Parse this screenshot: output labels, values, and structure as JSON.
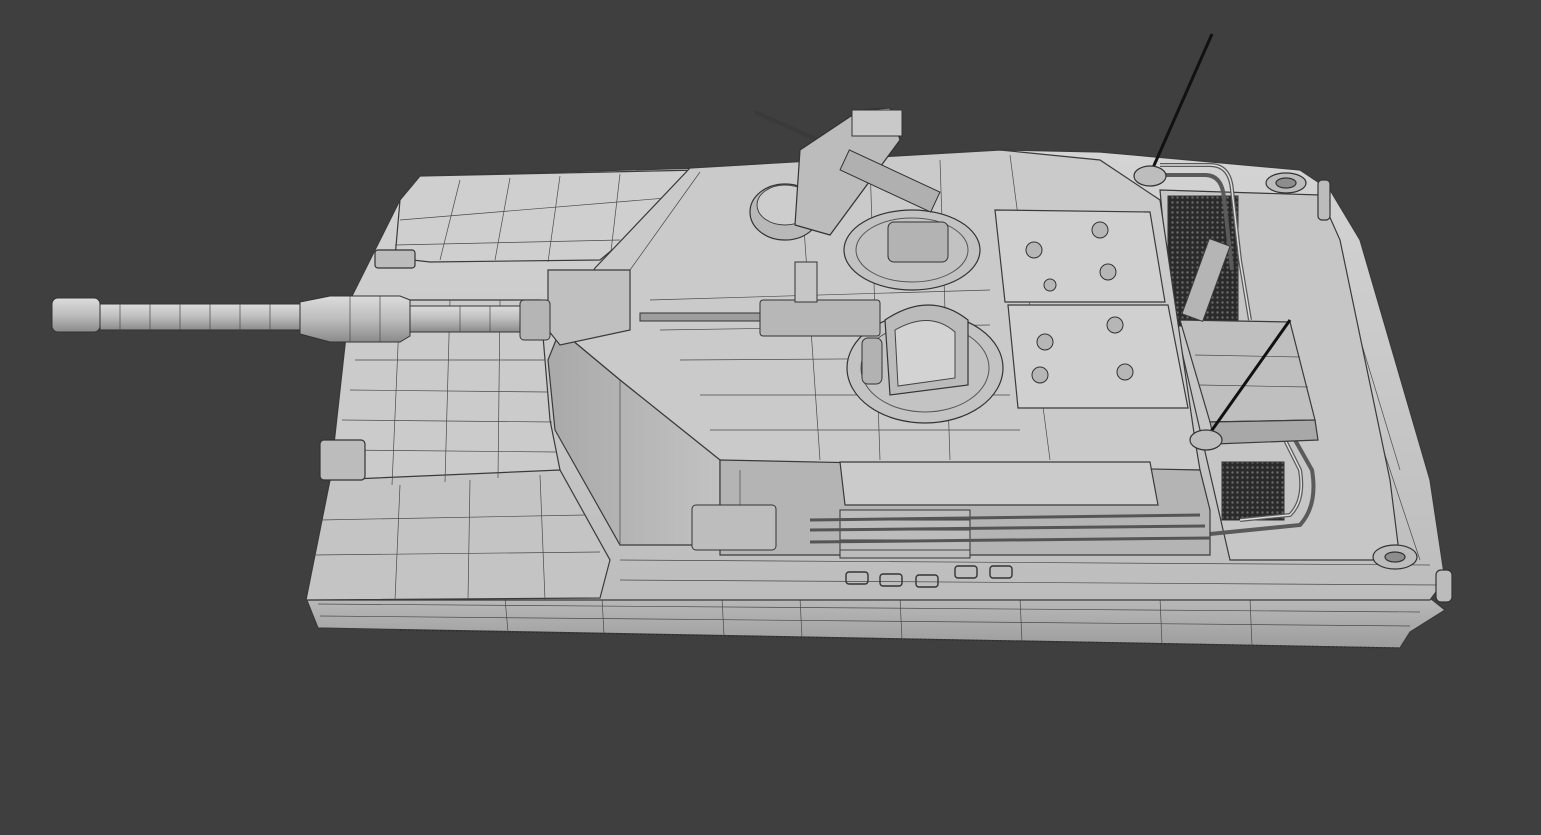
{
  "viewport": {
    "background_color": "#3f3f3f",
    "model": "tank-wireframe-render"
  },
  "colors": {
    "surface_light": "#c9c9c9",
    "surface_mid": "#b4b4b4",
    "surface_dark": "#8e8e8e",
    "edge_line": "#3a3a3a",
    "mesh_dark": "#1e1e1e"
  }
}
